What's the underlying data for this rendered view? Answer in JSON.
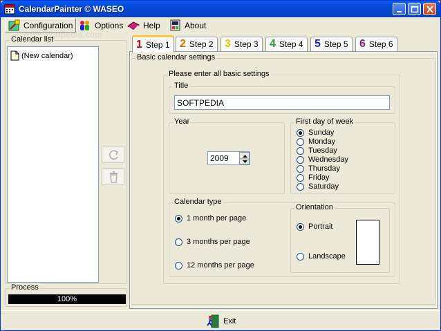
{
  "window": {
    "title": "CalendarPainter © WASEO"
  },
  "menu": [
    {
      "label": "Configuration",
      "icon": "palette-icon"
    },
    {
      "label": "Options",
      "icon": "people-icon"
    },
    {
      "label": "Help",
      "icon": "book-icon"
    },
    {
      "label": "About",
      "icon": "info-icon"
    }
  ],
  "watermark": "www.softpedia.com",
  "sidebar": {
    "calendar_list_label": "Calendar list",
    "items": [
      {
        "label": "(New calendar)"
      }
    ],
    "process_label": "Process",
    "progress_text": "100%",
    "progress": 1.0
  },
  "tabs": [
    {
      "number": "1",
      "label": "Step 1",
      "color": "#d40000"
    },
    {
      "number": "2",
      "label": "Step 2",
      "color": "#e07000"
    },
    {
      "number": "3",
      "label": "Step 3",
      "color": "#e8c800"
    },
    {
      "number": "4",
      "label": "Step 4",
      "color": "#2a9a2a"
    },
    {
      "number": "5",
      "label": "Step 5",
      "color": "#1c1cd0"
    },
    {
      "number": "6",
      "label": "Step 6",
      "color": "#8a1a8a"
    }
  ],
  "panel": {
    "basic_label": "Basic calendar settings",
    "please_label": "Please enter all basic settings",
    "title_label": "Title",
    "title_value": "SOFTPEDIA",
    "year_label": "Year",
    "year_value": "2009",
    "first_day_label": "First day of week",
    "days": [
      "Sunday",
      "Monday",
      "Tuesday",
      "Wednesday",
      "Thursday",
      "Friday",
      "Saturday"
    ],
    "selected_day": "Sunday",
    "calendar_type_label": "Calendar type",
    "calendar_types": [
      "1 month per page",
      "3 months per page",
      "12 months per page"
    ],
    "selected_type": "1 month per page",
    "orientation_label": "Orientation",
    "orientations": [
      "Portrait",
      "Landscape"
    ],
    "selected_orientation": "Portrait"
  },
  "footer": {
    "exit_label": "Exit"
  }
}
